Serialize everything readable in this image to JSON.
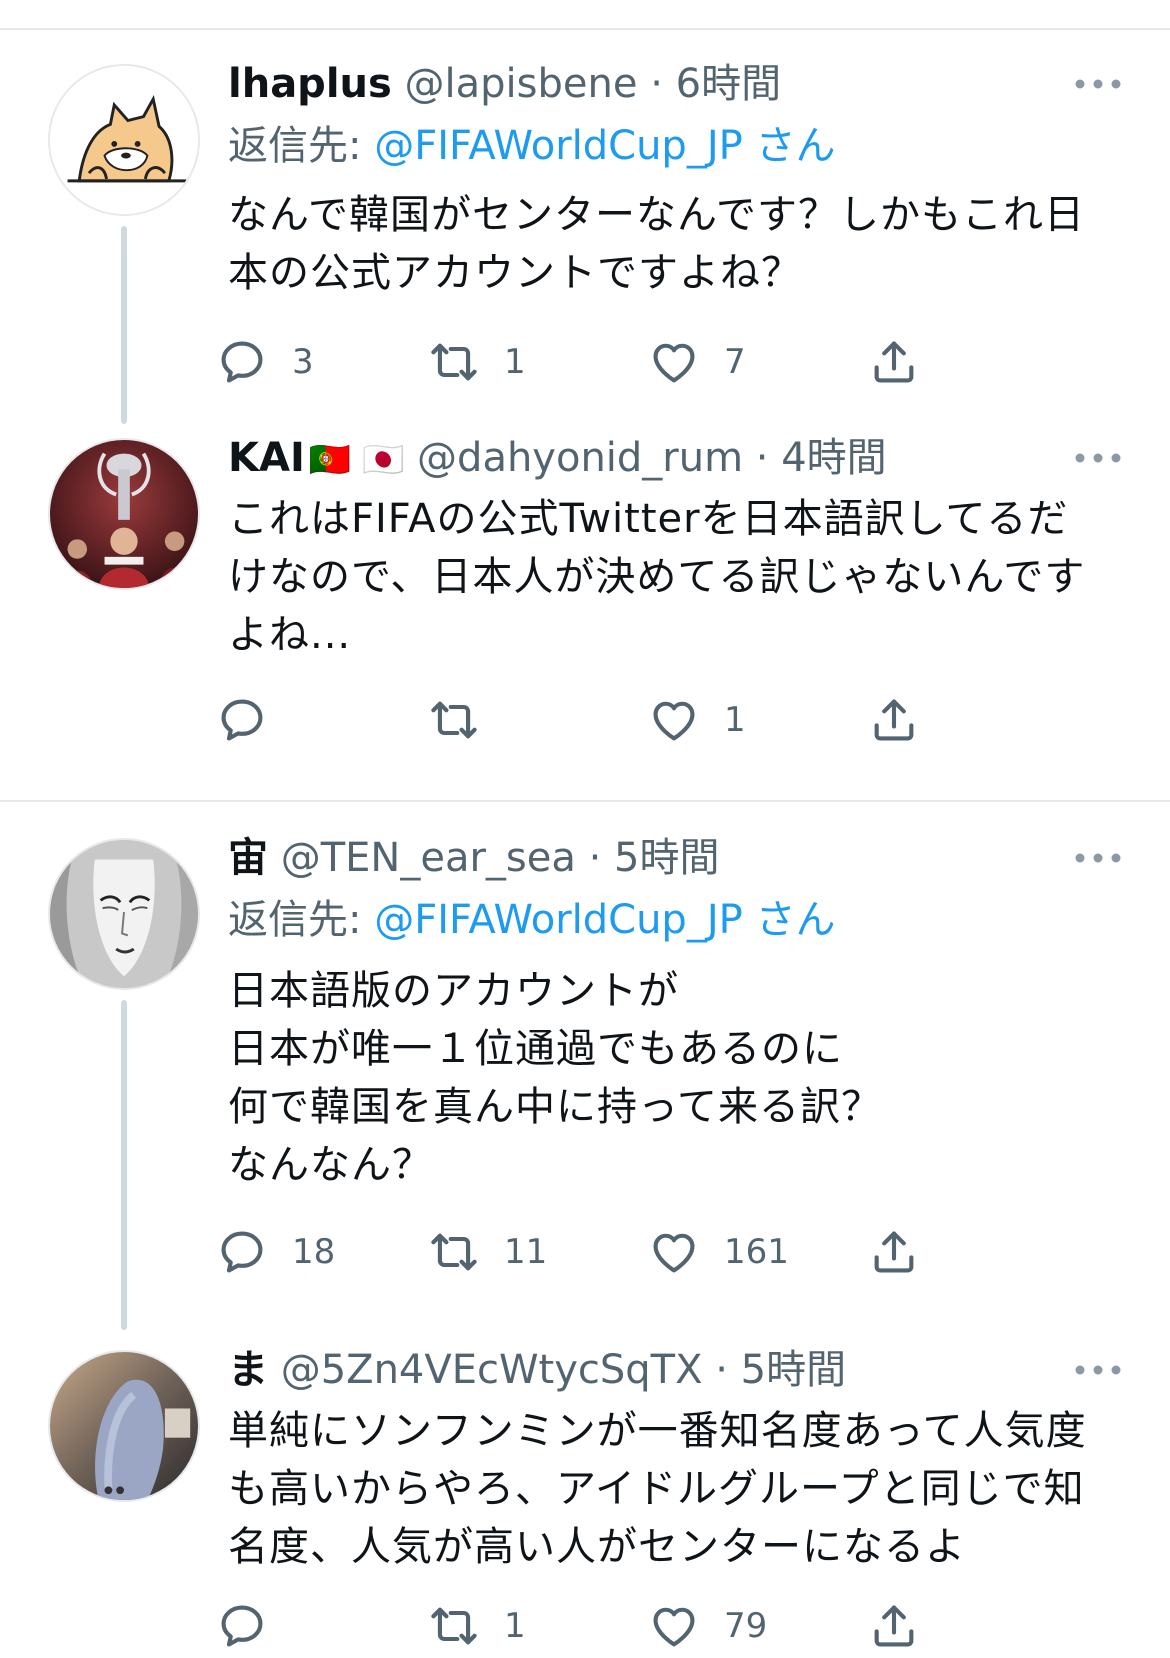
{
  "tweets": [
    {
      "name": "lhaplus",
      "handle": "@lapisbene",
      "sep": "·",
      "time": "6時間",
      "reply_label": "返信先: ",
      "reply_to": "@FIFAWorldCup_JP さん",
      "text": "なんで韓国がセンターなんです？しかもこれ日\n本の公式アカウントですよね？",
      "reply_count": "3",
      "retweet_count": "1",
      "like_count": "7",
      "avatar_icon": "shiba-dog-avatar"
    },
    {
      "name": "KAI",
      "flags": "🇵🇹 🇯🇵",
      "handle": "@dahyonid_rum",
      "sep": "·",
      "time": "4時間",
      "text": "これはFIFAの公式Twitterを日本語訳してるだ\nけなので、日本人が決めてる訳じゃないんです\nよね...",
      "reply_count": "",
      "retweet_count": "",
      "like_count": "1",
      "avatar_icon": "trophy-photo-avatar"
    },
    {
      "name": "宙",
      "handle": "@TEN_ear_sea",
      "sep": "·",
      "time": "5時間",
      "reply_label": "返信先: ",
      "reply_to": "@FIFAWorldCup_JP さん",
      "text": "日本語版のアカウントが\n日本が唯一１位通過でもあるのに\n何で韓国を真ん中に持って来る訳？\nなんなん？",
      "reply_count": "18",
      "retweet_count": "11",
      "like_count": "161",
      "avatar_icon": "illustrated-face-avatar"
    },
    {
      "name": "ま",
      "handle": "@5Zn4VEcWtycSqTX",
      "sep": "·",
      "time": "5時間",
      "text": "単純にソンフンミンが一番知名度あって人気度\nも高いからやろ、アイドルグループと同じで知\n名度、人気が高い人がセンターになるよ",
      "reply_count": "",
      "retweet_count": "1",
      "like_count": "79",
      "avatar_icon": "photo-avatar"
    }
  ],
  "colors": {
    "accent": "#1d9bf0",
    "secondary_text": "#536471",
    "primary_text": "#0f1419",
    "divider": "#e6e9ec",
    "thread_line": "#cfd9de"
  }
}
